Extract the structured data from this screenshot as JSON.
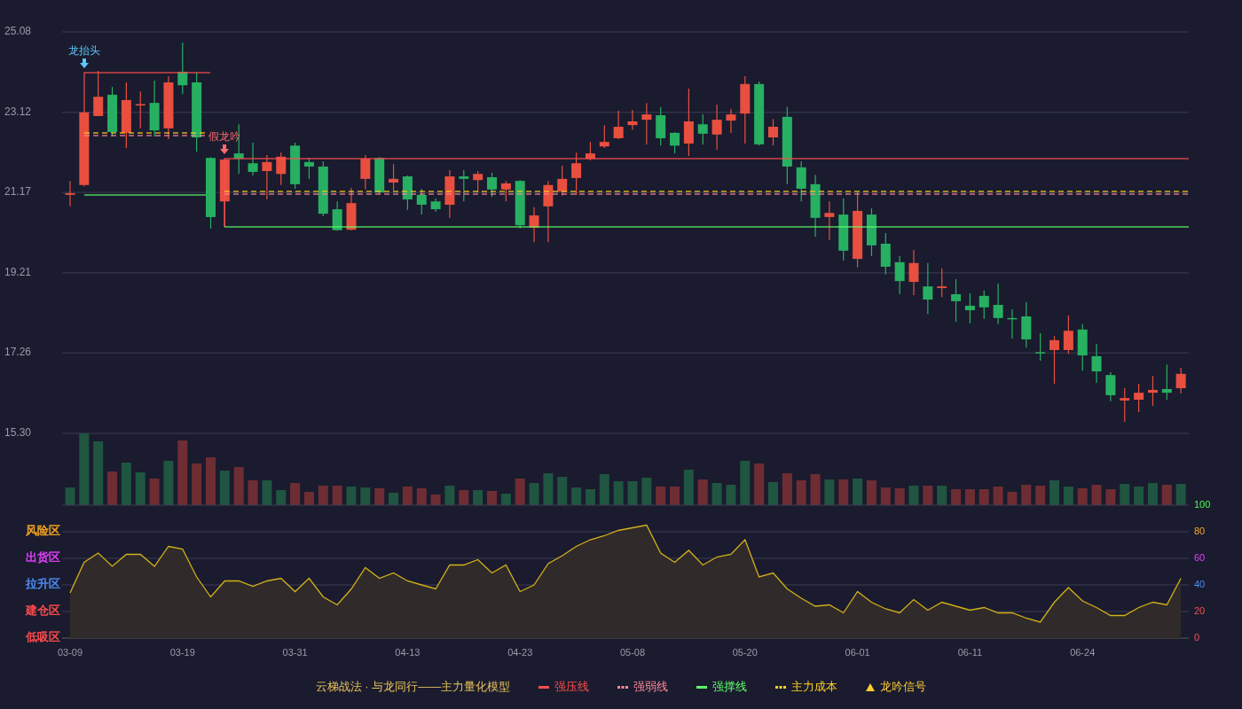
{
  "price_chart": {
    "chart_data": {
      "type": "candlestick",
      "grid": true,
      "ylim": [
        15.3,
        25.08
      ],
      "yticks": [
        {
          "value": 25.08,
          "label": "25.08"
        },
        {
          "value": 23.12,
          "label": "23.12"
        },
        {
          "value": 21.17,
          "label": "21.17"
        },
        {
          "value": 19.21,
          "label": "19.21"
        },
        {
          "value": 17.26,
          "label": "17.26"
        },
        {
          "value": 15.3,
          "label": "15.30"
        }
      ],
      "ohlc": [
        [
          21.11,
          21.45,
          20.83,
          21.15
        ],
        [
          21.35,
          23.14,
          21.32,
          23.12
        ],
        [
          23.03,
          24.13,
          23.03,
          23.5
        ],
        [
          23.55,
          23.74,
          22.53,
          22.64
        ],
        [
          22.62,
          23.85,
          22.25,
          23.42
        ],
        [
          23.31,
          23.63,
          22.73,
          23.32
        ],
        [
          23.35,
          23.89,
          22.53,
          22.68
        ],
        [
          22.73,
          24.0,
          22.47,
          23.85
        ],
        [
          24.11,
          24.82,
          23.57,
          23.78
        ],
        [
          23.85,
          24.09,
          22.16,
          22.51
        ],
        [
          22.01,
          22.03,
          20.29,
          20.57
        ],
        [
          20.95,
          21.97,
          20.33,
          21.97
        ],
        [
          22.12,
          22.83,
          21.62,
          21.99
        ],
        [
          21.88,
          22.38,
          21.58,
          21.67
        ],
        [
          21.69,
          22.08,
          21.0,
          21.91
        ],
        [
          21.62,
          22.14,
          21.35,
          22.04
        ],
        [
          22.31,
          22.38,
          21.26,
          21.37
        ],
        [
          21.91,
          22.01,
          21.5,
          21.8
        ],
        [
          21.8,
          21.93,
          20.59,
          20.65
        ],
        [
          20.76,
          20.95,
          20.24,
          20.25
        ],
        [
          20.26,
          21.28,
          20.25,
          20.91
        ],
        [
          21.5,
          22.08,
          21.24,
          21.99
        ],
        [
          22.01,
          22.03,
          21.13,
          21.17
        ],
        [
          21.41,
          21.86,
          21.22,
          21.5
        ],
        [
          21.56,
          21.58,
          20.74,
          21.0
        ],
        [
          21.11,
          21.26,
          20.63,
          20.87
        ],
        [
          20.95,
          21.02,
          20.7,
          20.76
        ],
        [
          20.87,
          21.71,
          20.55,
          21.56
        ],
        [
          21.56,
          21.71,
          20.95,
          21.5
        ],
        [
          21.47,
          21.69,
          21.17,
          21.62
        ],
        [
          21.54,
          21.65,
          21.06,
          21.24
        ],
        [
          21.24,
          21.45,
          20.95,
          21.39
        ],
        [
          21.45,
          21.47,
          20.29,
          20.37
        ],
        [
          20.31,
          20.81,
          19.96,
          20.61
        ],
        [
          20.83,
          21.45,
          19.96,
          21.35
        ],
        [
          21.19,
          21.82,
          21.09,
          21.5
        ],
        [
          21.52,
          22.14,
          21.11,
          21.88
        ],
        [
          21.99,
          22.4,
          21.95,
          22.12
        ],
        [
          22.29,
          22.81,
          22.25,
          22.4
        ],
        [
          22.49,
          23.16,
          22.47,
          22.77
        ],
        [
          22.81,
          23.18,
          22.7,
          22.9
        ],
        [
          22.94,
          23.35,
          22.34,
          23.07
        ],
        [
          23.05,
          23.25,
          22.31,
          22.49
        ],
        [
          22.62,
          22.64,
          22.12,
          22.31
        ],
        [
          22.36,
          23.7,
          22.06,
          22.9
        ],
        [
          22.83,
          23.07,
          22.34,
          22.6
        ],
        [
          22.58,
          23.31,
          22.21,
          22.94
        ],
        [
          22.92,
          23.2,
          22.62,
          23.07
        ],
        [
          23.09,
          24.0,
          22.36,
          23.81
        ],
        [
          23.81,
          23.87,
          22.31,
          22.34
        ],
        [
          22.51,
          22.96,
          22.31,
          22.77
        ],
        [
          23.01,
          23.25,
          21.37,
          21.8
        ],
        [
          21.78,
          21.93,
          20.95,
          21.26
        ],
        [
          21.37,
          21.6,
          20.09,
          20.55
        ],
        [
          20.57,
          20.95,
          20.01,
          20.67
        ],
        [
          20.63,
          21.02,
          19.51,
          19.75
        ],
        [
          19.55,
          21.17,
          19.34,
          20.72
        ],
        [
          20.63,
          20.78,
          19.62,
          19.88
        ],
        [
          19.92,
          20.18,
          19.17,
          19.36
        ],
        [
          19.47,
          19.62,
          18.69,
          19.01
        ],
        [
          18.99,
          19.77,
          18.67,
          19.45
        ],
        [
          18.88,
          19.45,
          18.21,
          18.56
        ],
        [
          18.84,
          19.32,
          18.62,
          18.88
        ],
        [
          18.69,
          19.06,
          18.02,
          18.52
        ],
        [
          18.41,
          18.71,
          17.98,
          18.3
        ],
        [
          18.65,
          18.78,
          18.09,
          18.37
        ],
        [
          18.43,
          18.95,
          17.96,
          18.11
        ],
        [
          18.11,
          18.32,
          17.61,
          18.09
        ],
        [
          18.15,
          18.5,
          17.39,
          17.59
        ],
        [
          17.28,
          17.74,
          17.07,
          17.26
        ],
        [
          17.33,
          17.67,
          16.51,
          17.57
        ],
        [
          17.33,
          18.17,
          17.24,
          17.8
        ],
        [
          17.83,
          17.96,
          16.83,
          17.2
        ],
        [
          17.18,
          17.48,
          16.53,
          16.81
        ],
        [
          16.72,
          16.79,
          16.08,
          16.23
        ],
        [
          16.1,
          16.4,
          15.58,
          16.16
        ],
        [
          16.12,
          16.51,
          15.82,
          16.29
        ],
        [
          16.29,
          16.7,
          15.97,
          16.36
        ],
        [
          16.38,
          16.98,
          16.12,
          16.29
        ],
        [
          16.4,
          16.9,
          16.27,
          16.75
        ]
      ]
    },
    "signals": [
      {
        "text": "龙抬头"
      },
      {
        "text": "假龙吟"
      }
    ]
  },
  "oscillator": {
    "zones": [
      {
        "label": "风险区",
        "color": "#f5a623"
      },
      {
        "label": "出货区",
        "color": "#e040fb"
      },
      {
        "label": "拉升区",
        "color": "#4d8df5"
      },
      {
        "label": "建仓区",
        "color": "#ff4d4d"
      },
      {
        "label": "低吸区",
        "color": "#ff4d4d"
      }
    ],
    "chart_data": {
      "type": "area",
      "grid": true,
      "ylim": [
        0,
        100
      ],
      "yticks": [
        0,
        20,
        40,
        60,
        80,
        100
      ],
      "categories": [
        "03-09",
        null,
        null,
        null,
        null,
        null,
        null,
        null,
        "03-19",
        null,
        null,
        null,
        null,
        null,
        null,
        null,
        "03-31",
        null,
        null,
        null,
        null,
        null,
        null,
        null,
        "04-13",
        null,
        null,
        null,
        null,
        null,
        null,
        null,
        "04-23",
        null,
        null,
        null,
        null,
        null,
        null,
        null,
        "05-08",
        null,
        null,
        null,
        null,
        null,
        null,
        null,
        "05-20",
        null,
        null,
        null,
        null,
        null,
        null,
        null,
        "06-01",
        null,
        null,
        null,
        null,
        null,
        null,
        null,
        "06-11",
        null,
        null,
        null,
        null,
        null,
        null,
        null,
        "06-24",
        null,
        null,
        null,
        null,
        null,
        null,
        null
      ],
      "series": [
        {
          "color": "#d4b019",
          "values": [
            34,
            57,
            64,
            54,
            63,
            63,
            54,
            69,
            67,
            46,
            31,
            43,
            43,
            39,
            43,
            45,
            35,
            45,
            31,
            25,
            37,
            53,
            45,
            49,
            43,
            40,
            37,
            55,
            55,
            59,
            49,
            55,
            35,
            40,
            56,
            62,
            69,
            74,
            77,
            81,
            83,
            85,
            64,
            57,
            66,
            55,
            61,
            63,
            74,
            46,
            49,
            37,
            30,
            24,
            25,
            19,
            35,
            27,
            22,
            19,
            29,
            21,
            27,
            24,
            21,
            23,
            19,
            19,
            15,
            12,
            27,
            38,
            28,
            23,
            17,
            17,
            23,
            27,
            25,
            45
          ]
        }
      ]
    }
  },
  "legend": {
    "title": "云梯战法 · 与龙同行——主力量化模型",
    "items": [
      {
        "kind": "resistance",
        "label": "强压线",
        "color": "#ff4d4d"
      },
      {
        "kind": "strength",
        "label": "强弱线",
        "color": "#ff8a9a"
      },
      {
        "kind": "support",
        "label": "强撑线",
        "color": "#5dff6a"
      },
      {
        "kind": "cost",
        "label": "主力成本",
        "color": "#ffd21f"
      },
      {
        "kind": "signal",
        "label": "龙吟信号",
        "color": "#ffcc33"
      }
    ]
  }
}
